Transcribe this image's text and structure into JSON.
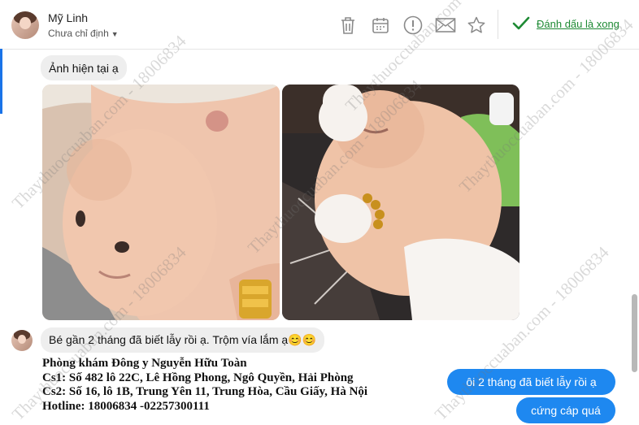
{
  "header": {
    "contact_name": "Mỹ Linh",
    "assign_label": "Chưa chỉ định",
    "mark_done_label": "Đánh dấu là xong"
  },
  "icons": {
    "delete": "trash-icon",
    "schedule": "calendar-icon",
    "spam": "exclamation-circle-icon",
    "mail": "envelope-icon",
    "star": "star-icon",
    "check": "checkmark-icon"
  },
  "colors": {
    "accent_blue": "#1a73e8",
    "outgoing_bubble": "#1e88f0",
    "incoming_bubble": "#eeeeee",
    "done_green": "#1e8a34"
  },
  "messages": {
    "incoming_1": "Ảnh hiện tại ạ",
    "incoming_2": "Bé gần 2 tháng đã biết lẫy rồi ạ. Trộm vía lắm ạ😊😊",
    "outgoing_1": "ôi 2 tháng đã biết lẫy rồi ạ",
    "outgoing_2": "cứng cáp quá"
  },
  "clinic_info": {
    "line1": "Phòng khám Đông y Nguyễn Hữu Toàn",
    "line2": "Cs1: Số 482 lô 22C, Lê Hồng Phong, Ngô Quyền, Hải Phòng",
    "line3": "Cs2: Số 16, lô 1B, Trung Yên 11, Trung Hòa, Cầu Giấy, Hà Nội",
    "line4": "Hotline: 18006834 -02257300111"
  },
  "watermarks": {
    "w1": "Thaythuoccuaban.com - 18006834",
    "w2": "Thaythuoccuaban.com - 18006834",
    "w3": "Thaythuoccuaban.com - 18006834",
    "w4": "Thaythuoccuaban.com - 18006834",
    "w5": "Thaythuoccuaban.com - 18006834",
    "w6": "Thaythuoccuaban.com - 18006834"
  }
}
